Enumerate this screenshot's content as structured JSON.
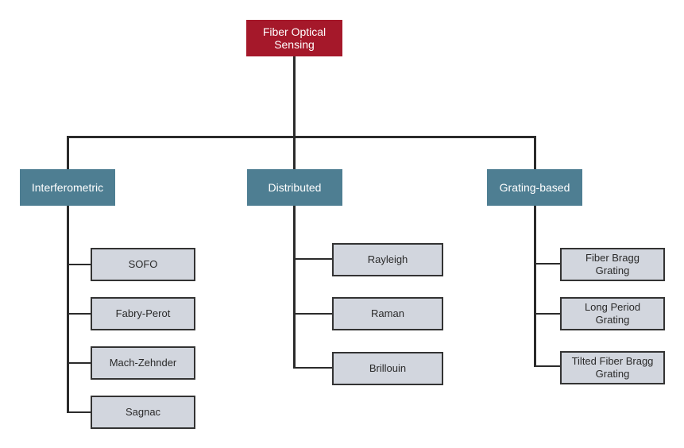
{
  "diagram": {
    "type": "tree",
    "colors": {
      "root": "#a5182a",
      "category": "#4e7e92",
      "leaf": "#d2d6de",
      "connector": "#2b2b2b"
    },
    "root": {
      "label": "Fiber Optical\nSensing"
    },
    "categories": [
      {
        "label": "Interferometric",
        "children": [
          {
            "label": "SOFO"
          },
          {
            "label": "Fabry-Perot"
          },
          {
            "label": "Mach-Zehnder"
          },
          {
            "label": "Sagnac"
          }
        ]
      },
      {
        "label": "Distributed",
        "children": [
          {
            "label": "Rayleigh"
          },
          {
            "label": "Raman"
          },
          {
            "label": "Brillouin"
          }
        ]
      },
      {
        "label": "Grating-based",
        "children": [
          {
            "label": "Fiber Bragg\nGrating"
          },
          {
            "label": "Long Period\nGrating"
          },
          {
            "label": "Tilted Fiber Bragg\nGrating"
          }
        ]
      }
    ]
  }
}
